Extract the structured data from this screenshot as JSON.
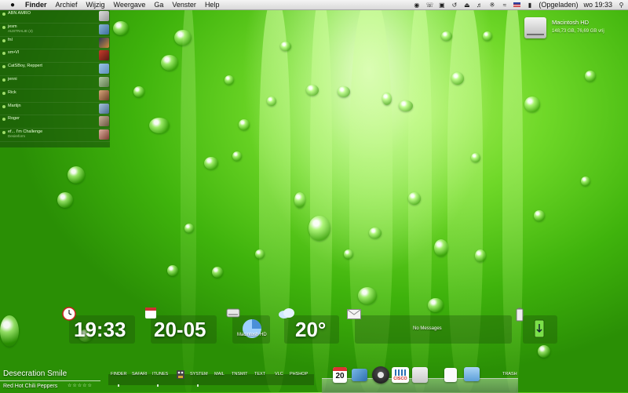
{
  "menubar": {
    "apple": "",
    "items": [
      "Finder",
      "Archief",
      "Wijzig",
      "Weergave",
      "Ga",
      "Venster",
      "Help"
    ],
    "battery_status": "(Opgeladen)",
    "clock": "wo 19:33"
  },
  "chat": {
    "header": "ABN AMRO",
    "entries": [
      {
        "name": "jesm",
        "sub": "AUSTRALIE (4)"
      },
      {
        "name": "fnl",
        "sub": ""
      },
      {
        "name": "sm•Vl",
        "sub": ""
      },
      {
        "name": "CatSBoy, Reppert",
        "sub": ""
      },
      {
        "name": "jenni",
        "sub": ""
      },
      {
        "name": "Rick",
        "sub": ""
      },
      {
        "name": "Martijn",
        "sub": ""
      },
      {
        "name": "Roger",
        "sub": ""
      },
      {
        "name": "ef... I'm Challenge",
        "sub": "Desireform"
      }
    ]
  },
  "disk": {
    "name": "Macintosh HD",
    "info": "148,73 GB, 76,69 GB vrij"
  },
  "widgets": {
    "time": "19:33",
    "date": "20-05",
    "drive_label": "Macintosh HD",
    "temperature": "20°",
    "mail_status": "No Messages"
  },
  "now_playing": {
    "title": "Desecration Smile",
    "artist": "Red Hot Chili Peppers",
    "stars": "☆☆☆☆☆"
  },
  "shelf_labels": [
    "FINDER",
    "SAFARI",
    "ITUNES",
    "SYSTEM",
    "MAIL",
    "TNSMIT",
    "TEXT",
    "VLC",
    "PHSHOP"
  ],
  "dock": {
    "calendar_day": "20",
    "cisco_label": "CISCO",
    "trash_label": "TRASH"
  }
}
